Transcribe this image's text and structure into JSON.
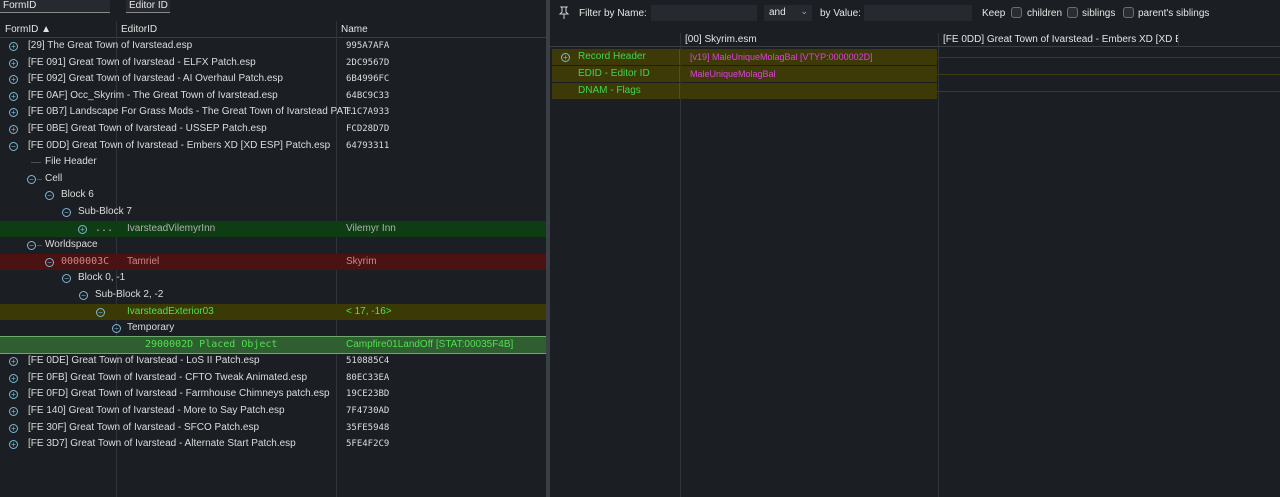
{
  "left": {
    "filters": {
      "formid_label": "FormID",
      "editorid_label": "Editor ID"
    },
    "columns": {
      "formid": "FormID ▲",
      "editorid": "EditorID",
      "name": "Name"
    },
    "rows": [
      {
        "text": "[29] The Great Town of Ivarstead.esp",
        "value": "995A7AFA"
      },
      {
        "text": "[FE 091] Great Town of Ivarstead - ELFX Patch.esp",
        "value": "2DC9567D"
      },
      {
        "text": "[FE 092] Great Town of Ivarstead - AI Overhaul Patch.esp",
        "value": "6B4996FC"
      },
      {
        "text": "[FE 0AF] Occ_Skyrim - The Great Town of Ivarstead.esp",
        "value": "64BC9C33"
      },
      {
        "text": "[FE 0B7] Landscape For Grass Mods - The Great Town of Ivarstead PAT...",
        "value": "F1C7A933"
      },
      {
        "text": "[FE 0BE] Great Town of Ivarstead - USSEP Patch.esp",
        "value": "FCD28D7D"
      },
      {
        "text": "[FE 0DD] Great Town of Ivarstead - Embers XD [XD ESP] Patch.esp",
        "value": "64793311"
      },
      {
        "text": "File Header",
        "value": ""
      },
      {
        "text": "Cell",
        "value": ""
      },
      {
        "text": "Block 6",
        "value": ""
      },
      {
        "text": "Sub-Block 7",
        "value": ""
      },
      {
        "text": "...",
        "editor": "IvarsteadVilemyrInn",
        "value": "Vilemyr Inn"
      },
      {
        "text": "Worldspace",
        "value": ""
      },
      {
        "text": "0000003C",
        "editor": "Tamriel",
        "value": "Skyrim"
      },
      {
        "text": "Block 0, -1",
        "value": ""
      },
      {
        "text": "Sub-Block 2, -2",
        "value": ""
      },
      {
        "text": "IvarsteadExterior03",
        "value": "< 17, -16>"
      },
      {
        "text": "Temporary",
        "value": ""
      },
      {
        "text": "2900002D  Placed Object",
        "value": "Campfire01LandOff [STAT:00035F4B]"
      },
      {
        "text": "[FE 0DE] Great Town of Ivarstead - LoS II Patch.esp",
        "value": "510885C4"
      },
      {
        "text": "[FE 0FB] Great Town of Ivarstead - CFTO Tweak Animated.esp",
        "value": "80EC33EA"
      },
      {
        "text": "[FE 0FD] Great Town of Ivarstead - Farmhouse Chimneys patch.esp",
        "value": "19CE23BD"
      },
      {
        "text": "[FE 140] Great Town of Ivarstead - More to Say Patch.esp",
        "value": "7F4730AD"
      },
      {
        "text": "[FE 30F] Great Town of Ivarstead - SFCO Patch.esp",
        "value": "35FE5948"
      },
      {
        "text": "[FE 3D7] Great Town of Ivarstead - Alternate Start Patch.esp",
        "value": "5FE4F2C9"
      }
    ]
  },
  "right": {
    "filter": {
      "by_name_label": "Filter by Name:",
      "and_label": "and",
      "by_value_label": "by Value:",
      "keep_label": "Keep",
      "children_label": "children",
      "siblings_label": "siblings",
      "parents_siblings_label": "parent's siblings"
    },
    "columns": {
      "col1": "[00] Skyrim.esm",
      "col2": "[FE 0DD] Great Town of Ivarstead - Embers XD [XD ES..."
    },
    "records": [
      {
        "label": "Record Header",
        "value": "[v19] MaleUniqueMolagBal [VTYP:0000002D]"
      },
      {
        "label": "EDID - Editor ID",
        "value": "MaleUniqueMolagBal"
      },
      {
        "label": "DNAM - Flags",
        "value": ""
      }
    ]
  },
  "colors": {
    "background": "#1b1e23",
    "green_text": "#4fe04f",
    "magenta_text": "#e040e0",
    "olive_row": "#3d3a08",
    "red_row": "#4a1212"
  }
}
